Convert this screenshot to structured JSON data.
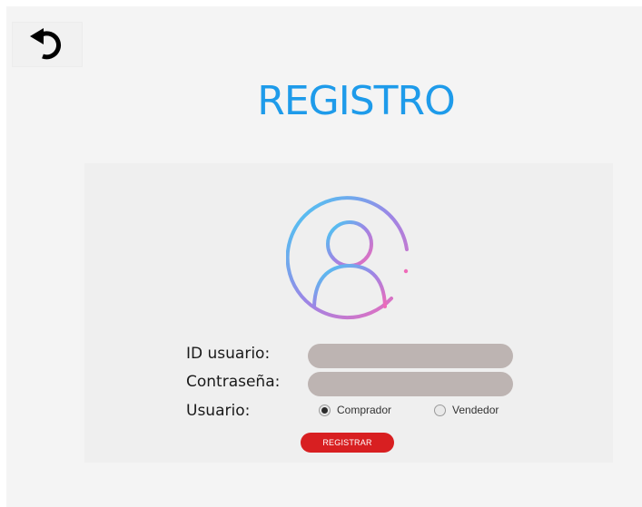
{
  "header": {
    "back_icon": "undo-arrow-icon",
    "title": "REGISTRO"
  },
  "form": {
    "avatar_icon": "user-avatar-icon",
    "user_id_label": "ID usuario:",
    "user_id_value": "",
    "password_label": "Contraseña:",
    "password_value": "",
    "user_type_label": "Usuario:",
    "options": [
      {
        "label": "Comprador",
        "selected": true
      },
      {
        "label": "Vendedor",
        "selected": false
      }
    ],
    "submit_label": "REGISTRAR"
  },
  "colors": {
    "title": "#1e9bea",
    "field_bg": "#bdb4b2",
    "submit_bg": "#d81f21",
    "avatar_gradient_start": "#3fd0f4",
    "avatar_gradient_mid": "#9b86e6",
    "avatar_gradient_end": "#ef6ab8"
  }
}
